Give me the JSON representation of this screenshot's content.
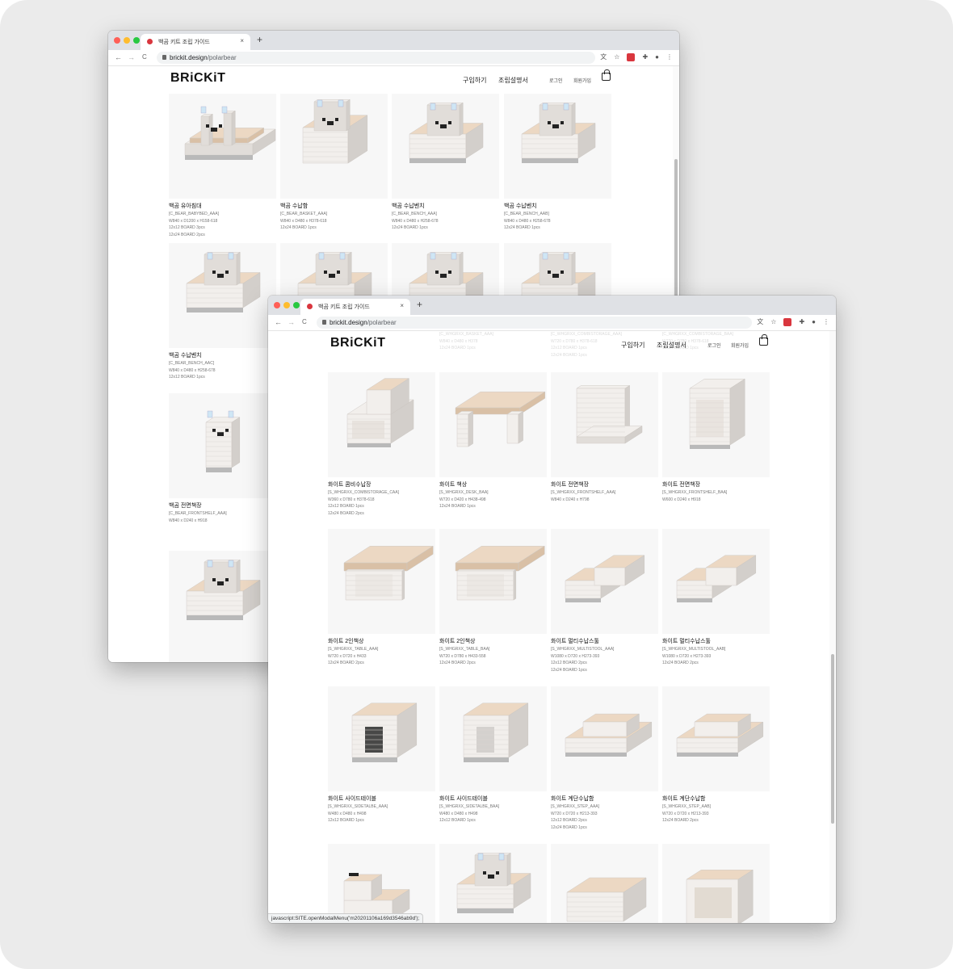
{
  "colors": {
    "traffic_red": "#ff5f57",
    "traffic_yellow": "#febc2e",
    "traffic_green": "#28c840",
    "favicon": "#d9363e"
  },
  "browser": {
    "tab_title": "백곰 키트 조립 가이드",
    "tab_close": "×",
    "new_tab": "+",
    "back": "←",
    "forward": "→",
    "reload": "C",
    "url_host": "brickit.design",
    "url_path": "/polarbear"
  },
  "site": {
    "logo": "BRiCKiT",
    "nav_buy": "구입하기",
    "nav_manual": "조립설명서",
    "nav_login": "로그인",
    "nav_signup": "회원가입"
  },
  "back_products": [
    {
      "name": "백곰 유아침대",
      "code": "[C_BEAR_BABYBED_AAA]",
      "size": "W840 x D1200 x H158-618",
      "boards": [
        "12x12 BOARD 3pcs",
        "12x24 BOARD 2pcs"
      ],
      "kind": "bed"
    },
    {
      "name": "백곰 수납함",
      "code": "[C_BEAR_BASKET_AAA]",
      "size": "W840 x D480 x H378-618",
      "boards": [
        "12x24 BOARD 1pcs"
      ],
      "kind": "basket"
    },
    {
      "name": "백곰 수납벤치",
      "code": "[C_BEAR_BENCH_AAA]",
      "size": "W840 x D480 x H258-678",
      "boards": [
        "12x24 BOARD 1pcs"
      ],
      "kind": "bench"
    },
    {
      "name": "백곰 수납벤치",
      "code": "[C_BEAR_BENCH_AAB]",
      "size": "W840 x D480 x H258-678",
      "boards": [
        "12x24 BOARD 1pcs"
      ],
      "kind": "bench"
    },
    {
      "name": "백곰 수납벤치",
      "code": "[C_BEAR_BENCH_AAC]",
      "size": "W840 x D480 x H258-678",
      "boards": [
        "12x12 BOARD 1pcs"
      ],
      "kind": "bench"
    },
    {
      "name": "백곰 전면책장",
      "code": "[C_BEAR_FRONTSHELF_AAA]",
      "size": "W840 x D240 x H918",
      "boards": [],
      "kind": "frontshelf"
    }
  ],
  "faded_products": [
    {
      "code": "[C_WHGRXX_BASKET_AAA]",
      "size": "W840 x D480 x H378",
      "boards": [
        "12x24 BOARD 1pcs"
      ]
    },
    {
      "code": "[C_WHGRXX_COMBISTORAGE_AAA]",
      "size": "W720 x D780 x H378-618",
      "boards": [
        "12x12 BOARD 1pcs",
        "12x24 BOARD 1pcs"
      ]
    },
    {
      "code": "[C_WHGRXX_COMBISTORAGE_BAA]",
      "size": "W720 x D780 x H378-618",
      "boards": [
        "12x24 BOARD 1pcs"
      ]
    }
  ],
  "front_products": [
    {
      "name": "화이트 콤비수납장",
      "code": "[S_WHGRXX_COMBISTORAGE_CAA]",
      "size": "W360 x D780 x H378-618",
      "boards": [
        "12x12 BOARD 1pcs",
        "12x24 BOARD 2pcs"
      ],
      "kind": "combi"
    },
    {
      "name": "화이트 책상",
      "code": "[S_WHGRXX_DESK_BAA]",
      "size": "W720 x D420 x H438-498",
      "boards": [
        "12x24 BOARD 1pcs"
      ],
      "kind": "desk"
    },
    {
      "name": "화이트 전면책장",
      "code": "[S_WHGRXX_FRONTSHELF_AAA]",
      "size": "W840 x D240 x H798",
      "boards": [],
      "kind": "shelf"
    },
    {
      "name": "화이트 전면책장",
      "code": "[S_WHGRXX_FRONTSHELF_BAA]",
      "size": "W600 x D240 x H918",
      "boards": [],
      "kind": "shelf2"
    },
    {
      "name": "화이트 2인책상",
      "code": "[S_WHGRXX_TABLE_AAA]",
      "size": "W720 x D720 x H433",
      "boards": [
        "12x24 BOARD 2pcs"
      ],
      "kind": "table"
    },
    {
      "name": "화이트 2인책상",
      "code": "[S_WHGRXX_TABLE_BAA]",
      "size": "W720 x D780 x H433-558",
      "boards": [
        "12x24 BOARD 2pcs"
      ],
      "kind": "table2"
    },
    {
      "name": "화이트 멀티수납스툴",
      "code": "[S_WHGRXX_MULTISTOOL_AAA]",
      "size": "W1080 x D720 x H273-393",
      "boards": [
        "12x12 BOARD 2pcs",
        "12x24 BOARD 1pcs"
      ],
      "kind": "multi"
    },
    {
      "name": "화이트 멀티수납스툴",
      "code": "[S_WHGRXX_MULTISTOOL_AAB]",
      "size": "W1080 x D720 x H273-393",
      "boards": [
        "12x24 BOARD 2pcs"
      ],
      "kind": "multi"
    },
    {
      "name": "화이트 사이드테이블",
      "code": "[S_WHGRXX_SIDETALBE_AAA]",
      "size": "W480 x D480 x H498",
      "boards": [
        "12x12 BOARD 1pcs"
      ],
      "kind": "side"
    },
    {
      "name": "화이트 사이드테이블",
      "code": "[S_WHGRXX_SIDETALBE_BAA]",
      "size": "W480 x D480 x H498",
      "boards": [
        "12x12 BOARD 1pcs"
      ],
      "kind": "side2"
    },
    {
      "name": "화이트 계단수납함",
      "code": "[S_WHGRXX_STEP_AAA]",
      "size": "W720 x D720 x H213-393",
      "boards": [
        "12x12 BOARD 2pcs",
        "12x24 BOARD 1pcs"
      ],
      "kind": "step"
    },
    {
      "name": "화이트 계단수납함",
      "code": "[S_WHGRXX_STEP_AAB]",
      "size": "W720 x D720 x H213-393",
      "boards": [
        "12x24 BOARD 2pcs"
      ],
      "kind": "step"
    }
  ],
  "front_partial_kinds": [
    "stepsmall",
    "bench",
    "box",
    "cabinet"
  ],
  "status_text": "javascript:SITE.openModalMenu('m20201106a169d3546ab9d');"
}
